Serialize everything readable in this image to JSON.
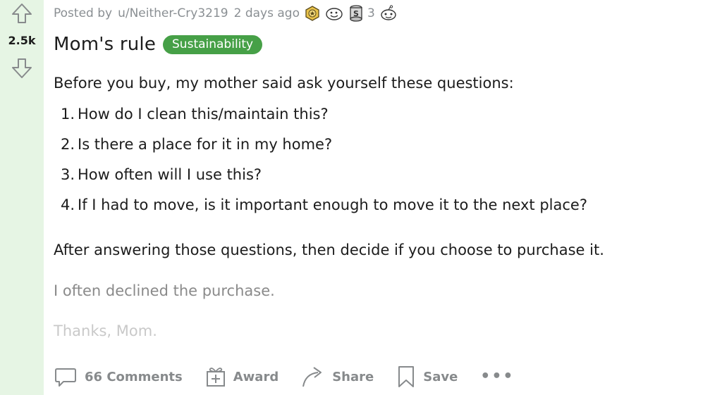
{
  "vote": {
    "score": "2.5k"
  },
  "post": {
    "meta_prefix": "Posted by",
    "author": "u/Neither-Cry3219",
    "age": "2 days ago",
    "award_count": "3",
    "title": "Mom's rule",
    "flair": "Sustainability",
    "intro": "Before you buy, my mother said ask yourself these questions:",
    "questions": [
      {
        "num": "1.",
        "text": "How do I clean this/maintain this?"
      },
      {
        "num": "2.",
        "text": "Is there a place for it in my home?"
      },
      {
        "num": "3.",
        "text": "How often will I use this?"
      },
      {
        "num": "4.",
        "text": "If I had to move, is it important enough to move it to the next place?"
      }
    ],
    "after": "After answering those questions, then decide if you choose to purchase it.",
    "declined": "I often declined the purchase.",
    "thanks": "Thanks, Mom."
  },
  "actions": {
    "comments": "66 Comments",
    "award": "Award",
    "share": "Share",
    "save": "Save",
    "more": "•••"
  },
  "colors": {
    "vote_bg": "#e6f5e4",
    "flair_bg": "#46a047",
    "meta_text": "#8a8f93",
    "action_text": "#878a8c"
  },
  "icons": [
    "upvote-arrow-icon",
    "downvote-arrow-icon",
    "award-medal-icon",
    "award-smiley-icon",
    "award-coin-icon",
    "award-snoo-icon",
    "comment-bubble-icon",
    "gift-icon",
    "share-arrow-icon",
    "bookmark-icon"
  ]
}
